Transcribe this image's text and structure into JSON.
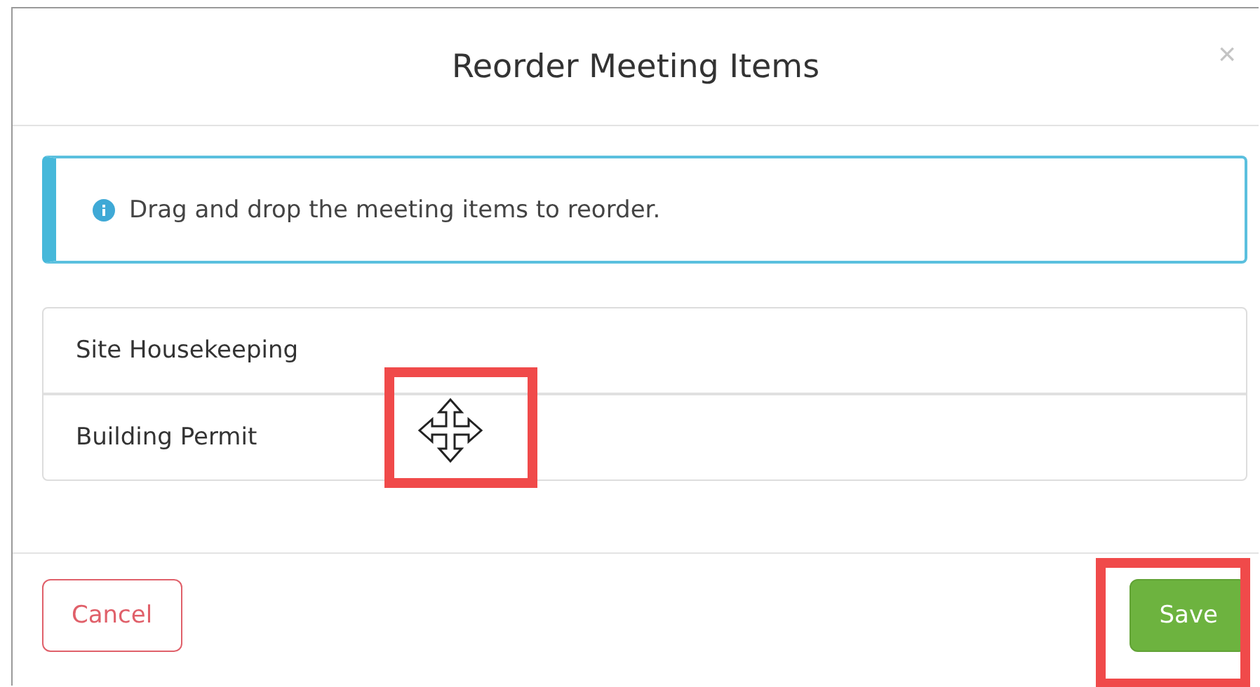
{
  "dialog": {
    "title": "Reorder Meeting Items",
    "close": "×"
  },
  "alert": {
    "kind": "info",
    "text": "Drag and drop the meeting items to reorder."
  },
  "items": [
    {
      "label": "Site Housekeeping"
    },
    {
      "label": "Building Permit"
    }
  ],
  "buttons": [
    {
      "kind": "cancel",
      "label": "Cancel"
    },
    {
      "kind": "save",
      "label": "Save"
    }
  ]
}
